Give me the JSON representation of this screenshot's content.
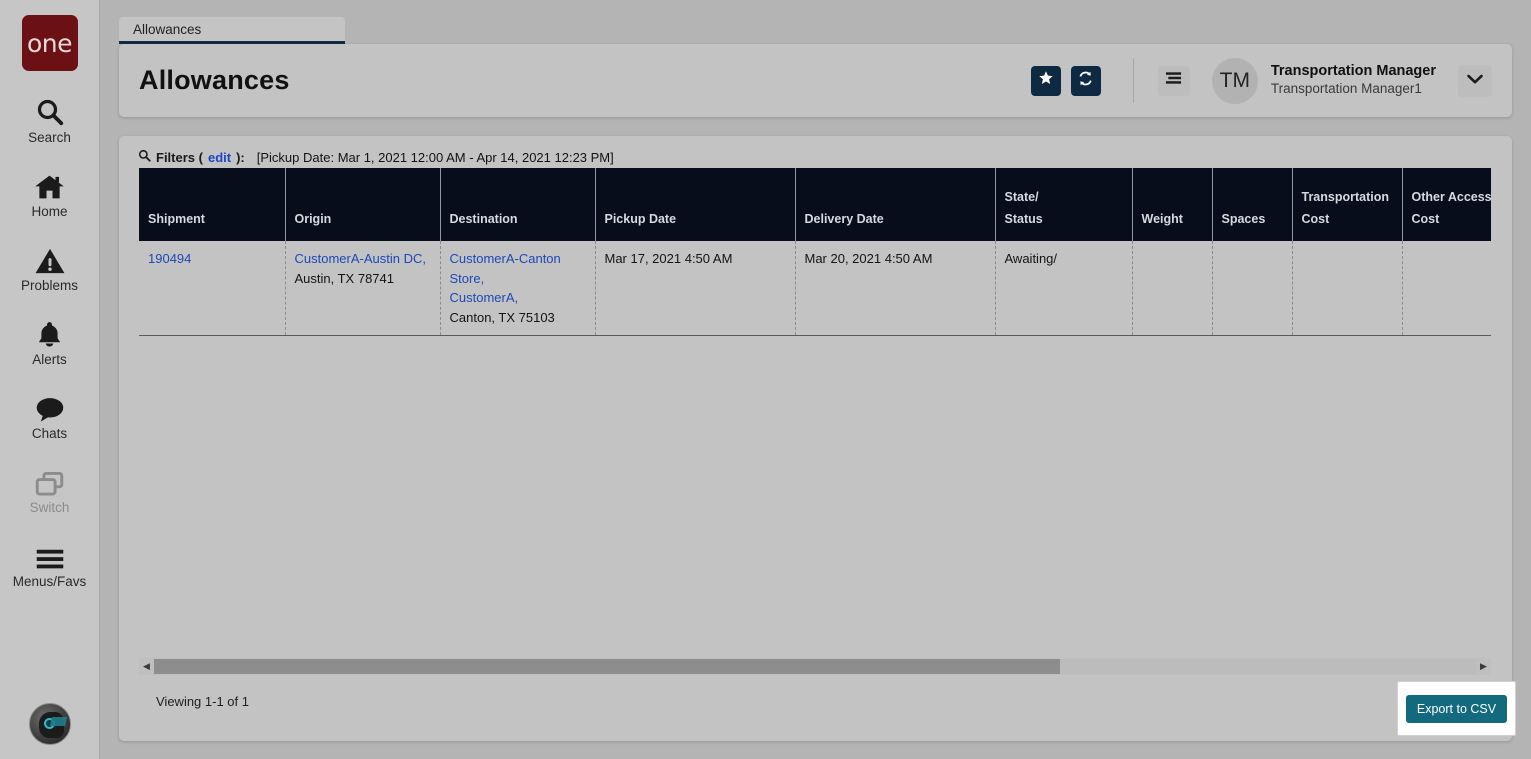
{
  "brand": {
    "logo_text": "one",
    "logo_color": "#6b1014"
  },
  "rail": {
    "items": [
      {
        "label": "Search",
        "icon": "search-icon",
        "disabled": false
      },
      {
        "label": "Home",
        "icon": "home-icon",
        "disabled": false
      },
      {
        "label": "Problems",
        "icon": "warning-triangle-icon",
        "disabled": false
      },
      {
        "label": "Alerts",
        "icon": "bell-icon",
        "disabled": false
      },
      {
        "label": "Chats",
        "icon": "chat-bubble-icon",
        "disabled": false
      },
      {
        "label": "Switch",
        "icon": "switch-windows-icon",
        "disabled": true
      },
      {
        "label": "Menus/Favs",
        "icon": "hamburger-icon",
        "disabled": false
      }
    ],
    "avatar_icon": "ai-assistant-avatar-icon"
  },
  "tabs": [
    {
      "label": "Allowances",
      "active": true
    }
  ],
  "header": {
    "title": "Allowances",
    "favorite_icon": "star-icon",
    "refresh_icon": "refresh-icon",
    "menu_icon": "list-menu-icon",
    "avatar_initials": "TM",
    "user_name": "Transportation Manager",
    "user_sub": "Transportation Manager1",
    "caret_icon": "chevron-down-icon",
    "accent_dark": "#0d2a42"
  },
  "filters": {
    "icon": "search-icon",
    "label": "Filters (",
    "edit_link": "edit",
    "label_end": "):",
    "value": "[Pickup Date: Mar 1, 2021 12:00 AM - Apr 14, 2021 12:23 PM]"
  },
  "table": {
    "columns": [
      "Shipment",
      "Origin",
      "Destination",
      "Pickup Date",
      "Delivery Date",
      "State/\nStatus",
      "Weight",
      "Spaces",
      "Transportation\nCost",
      "Other Accessorial\nCost"
    ],
    "rows": [
      {
        "shipment": "190494",
        "origin_link": "CustomerA-Austin DC,",
        "origin_addr": "Austin, TX 78741",
        "destination_link_1": "CustomerA-Canton Store,",
        "destination_link_2": "CustomerA,",
        "destination_addr": "Canton, TX 75103",
        "pickup_date": "Mar 17, 2021 4:50 AM",
        "delivery_date": "Mar 20, 2021 4:50 AM",
        "state_status": "Awaiting/",
        "weight": "",
        "spaces": "",
        "transportation_cost": "",
        "other_accessorial_cost": ""
      }
    ],
    "header_bg": "#070d1b"
  },
  "scrollbar": {
    "left_arrow": "◀",
    "right_arrow": "▶"
  },
  "footer": {
    "viewing": "Viewing 1-1 of 1",
    "export_label": "Export to CSV",
    "export_color": "#136a7e"
  }
}
